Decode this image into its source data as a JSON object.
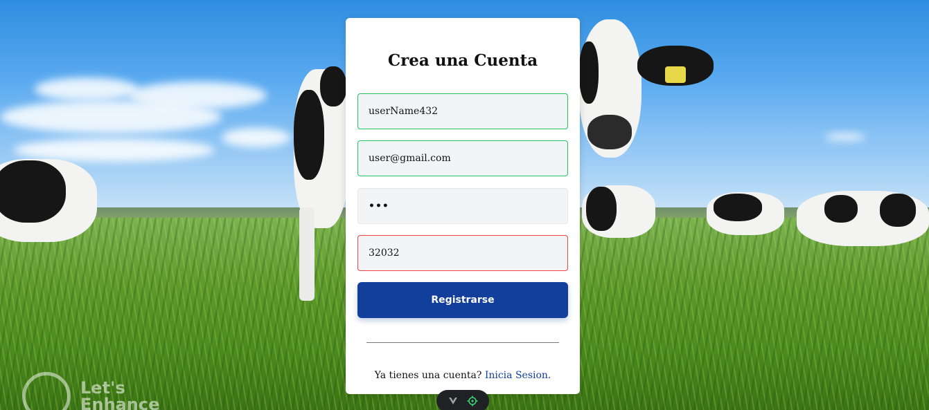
{
  "form": {
    "title": "Crea una Cuenta",
    "username_value": "userName432",
    "email_value": "user@gmail.com",
    "password_value": "•••",
    "code_value": "32032",
    "submit_label": "Registrarse"
  },
  "footer": {
    "prompt": "Ya tienes una cuenta?",
    "link_label": "Inicia Sesion."
  },
  "watermark": {
    "line1": "Let's",
    "line2": "Enhance"
  },
  "toolbar": {
    "icons": [
      "vite-logo-icon",
      "crosshair-icon"
    ]
  },
  "colors": {
    "primary": "#123e9c",
    "valid_border": "#22c55e",
    "invalid_border": "#ef4444",
    "input_bg": "#f3f4f6",
    "toolbar_accent": "#3fd17a"
  }
}
